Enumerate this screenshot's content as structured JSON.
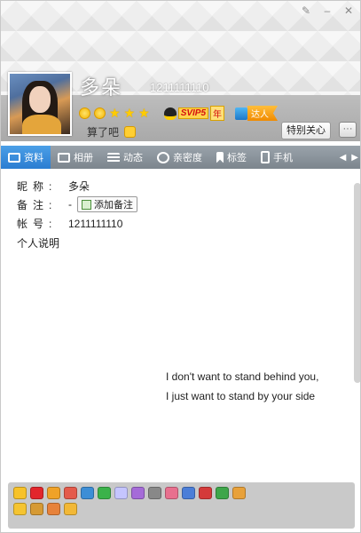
{
  "window": {
    "controls": {
      "pin_icon": "pin-icon",
      "minimize": "–",
      "close": "✕"
    }
  },
  "profile": {
    "nickname": "多朵",
    "account": "1211111110",
    "signature": "算了吧",
    "svip_tag": "SVIP5",
    "svip_year": "年",
    "daren_label": "达人",
    "care_button": "特别关心",
    "chat_icon": "···"
  },
  "tabs": [
    {
      "label": "资料",
      "icon": "profile-card-icon",
      "active": true
    },
    {
      "label": "相册",
      "icon": "photo-album-icon",
      "active": false
    },
    {
      "label": "动态",
      "icon": "feed-list-icon",
      "active": false
    },
    {
      "label": "亲密度",
      "icon": "heart-icon",
      "active": false
    },
    {
      "label": "标签",
      "icon": "bookmark-icon",
      "active": false
    },
    {
      "label": "手机",
      "icon": "phone-icon",
      "active": false
    }
  ],
  "tab_arrows": {
    "left": "◀",
    "right": "▶"
  },
  "info": {
    "nickname_label": "昵称:",
    "nickname_value": "多朵",
    "remark_label": "备注:",
    "remark_value": "-",
    "remark_button": "添加备注",
    "account_label": "帐号:",
    "account_value": "1211111110",
    "description_label": "个人说明",
    "description_lines": [
      "I don't want to stand behind you,",
      "I just want to stand by your side"
    ]
  },
  "colors": {
    "tab_active": "#2b7dd1",
    "tab_bar": "#8a939b",
    "header_band": "#b3b3b3",
    "bottom_panel": "#c9c9c9"
  },
  "bottom_icons": {
    "row1": [
      "#f7c229",
      "#e2262c",
      "#f0a228",
      "#e45b4b",
      "#3d8ed6",
      "#3bb24a",
      "#c5c5ff",
      "#a56bd8",
      "#888888",
      "#e86f8e",
      "#4b7ed8",
      "#d43a3a",
      "#3ea64a",
      "#e8a13a"
    ],
    "row2": [
      "#f5c431",
      "#d69a34",
      "#e7823a",
      "#f2b836"
    ]
  }
}
